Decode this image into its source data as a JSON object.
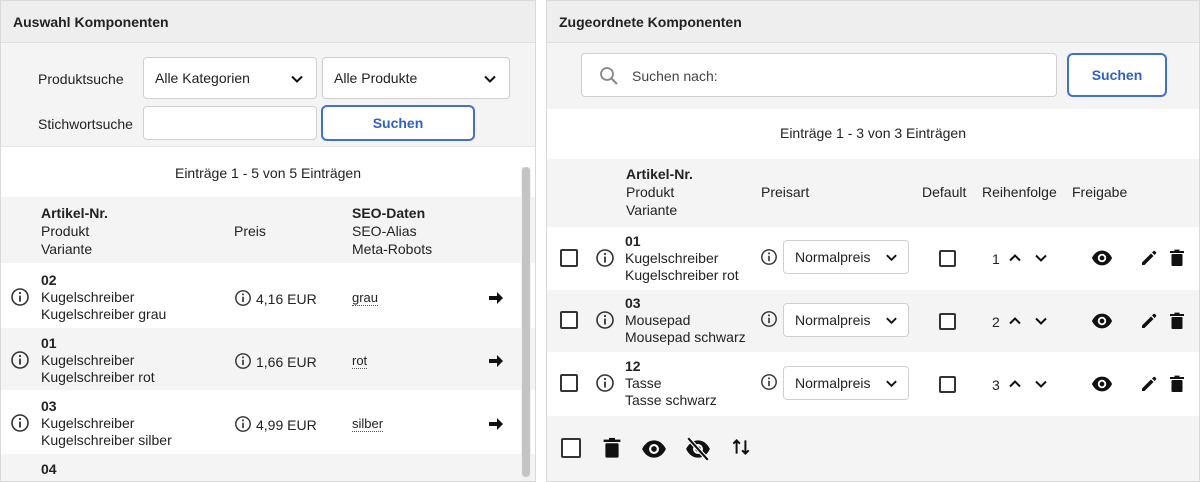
{
  "left": {
    "title": "Auswahl Komponenten",
    "filters": {
      "produktsuche_label": "Produktsuche",
      "stichwortsuche_label": "Stichwortsuche",
      "category_select": "Alle Kategorien",
      "product_select": "Alle Produkte",
      "keyword_value": "",
      "search_button": "Suchen"
    },
    "count": "Einträge 1 - 5 von 5 Einträgen",
    "headers": {
      "col1_line1": "Artikel-Nr.",
      "col1_line2": "Produkt",
      "col1_line3": "Variante",
      "col2": "Preis",
      "col3_line1": "SEO-Daten",
      "col3_line2": "SEO-Alias",
      "col3_line3": "Meta-Robots"
    },
    "rows": [
      {
        "nr": "02",
        "product": "Kugelschreiber",
        "variant": "Kugelschreiber grau",
        "price": "4,16 EUR",
        "seo": "grau"
      },
      {
        "nr": "01",
        "product": "Kugelschreiber",
        "variant": "Kugelschreiber rot",
        "price": "1,66 EUR",
        "seo": "rot"
      },
      {
        "nr": "03",
        "product": "Kugelschreiber",
        "variant": "Kugelschreiber silber",
        "price": "4,99 EUR",
        "seo": "silber"
      },
      {
        "nr": "04",
        "product": "",
        "variant": "",
        "price": "",
        "seo": ""
      }
    ]
  },
  "right": {
    "title": "Zugeordnete Komponenten",
    "search_placeholder": "Suchen nach:",
    "search_button": "Suchen",
    "count": "Einträge 1 - 3 von 3 Einträgen",
    "headers": {
      "col1_line1": "Artikel-Nr.",
      "col1_line2": "Produkt",
      "col1_line3": "Variante",
      "preisart": "Preisart",
      "default": "Default",
      "reihenfolge": "Reihenfolge",
      "freigabe": "Freigabe"
    },
    "rows": [
      {
        "nr": "01",
        "product": "Kugelschreiber",
        "variant": "Kugelschreiber rot",
        "preisart": "Normalpreis",
        "order": "1"
      },
      {
        "nr": "03",
        "product": "Mousepad",
        "variant": "Mousepad schwarz",
        "preisart": "Normalpreis",
        "order": "2"
      },
      {
        "nr": "12",
        "product": "Tasse",
        "variant": "Tasse schwarz",
        "preisart": "Normalpreis",
        "order": "3"
      }
    ]
  },
  "icons": {
    "info": "info-circle-icon",
    "arrow": "arrow-right-icon",
    "eye": "eye-icon",
    "eye_off": "eye-off-icon",
    "edit": "pencil-icon",
    "delete": "trash-icon",
    "sort": "sort-arrows-icon",
    "search": "magnifier-icon"
  },
  "colors": {
    "accent": "#3f6fd8",
    "header_bg": "#eeeeee",
    "stripe_bg": "#f4f4f4"
  }
}
